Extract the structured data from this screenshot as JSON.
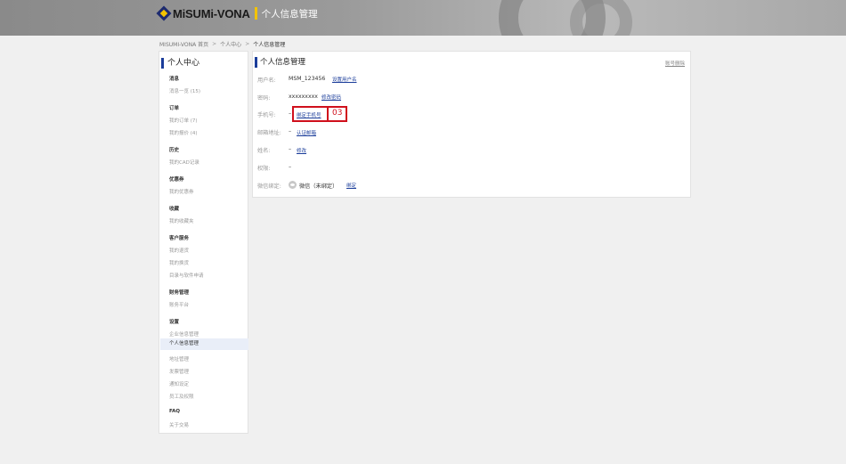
{
  "header": {
    "brand": "MiSUMi-VONA",
    "title": "个人信息管理"
  },
  "breadcrumb": {
    "items": [
      "MISUMI-VONA 首页",
      "个人中心",
      "个人信息管理"
    ],
    "separator": ">"
  },
  "sidebar": {
    "title": "个人中心",
    "groups": [
      {
        "label": "消息",
        "items": [
          "消息一览 (15)"
        ]
      },
      {
        "label": "订单",
        "items": [
          "我的订单 (7)",
          "我的报价 (4)"
        ]
      },
      {
        "label": "历史",
        "items": [
          "我的CAD记录"
        ]
      },
      {
        "label": "优惠券",
        "items": [
          "我的优惠券"
        ]
      },
      {
        "label": "收藏",
        "items": [
          "我的收藏夹"
        ]
      },
      {
        "label": "客户服务",
        "items": [
          "我的退货",
          "我的换货",
          "目录与软件申请"
        ]
      },
      {
        "label": "财务管理",
        "items": [
          "账务平台"
        ]
      },
      {
        "label": "设置",
        "items": [
          "企业信息管理",
          "个人信息管理",
          "地址管理",
          "发票管理",
          "通知设定",
          "员工及权限"
        ]
      },
      {
        "label": "FAQ",
        "items": [
          "关于交易"
        ]
      }
    ]
  },
  "panel": {
    "title": "个人信息管理",
    "top_link": "账号删除",
    "username_label": "用户名:",
    "username_value": "MSM_123456",
    "username_link": "设置用户名",
    "password_label": "密码:",
    "password_value": "xxxxxxxxx",
    "password_link": "修改密码",
    "phone_label": "手机号:",
    "phone_value": "–",
    "phone_link": "绑定手机号",
    "phone_annotation": "03",
    "email_label": "邮箱地址:",
    "email_value": "–",
    "email_link": "认证邮箱",
    "name_label": "姓名:",
    "name_value": "–",
    "name_link": "修改",
    "permission_label": "权限:",
    "permission_value": "–",
    "wechat_label": "微信绑定:",
    "wechat_value": "微信（未绑定）",
    "wechat_link": "绑定"
  },
  "colors": {
    "accent": "#1b3d9a",
    "brand_yellow": "#f3c300",
    "highlight_red": "#d0101c",
    "active_bg": "#e9eef8"
  }
}
